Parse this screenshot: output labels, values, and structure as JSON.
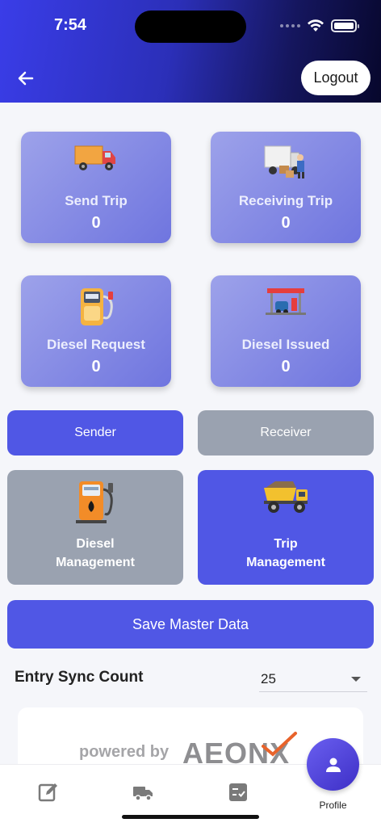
{
  "status_bar": {
    "time": "7:54"
  },
  "header": {
    "logout_label": "Logout"
  },
  "stats": [
    {
      "label": "Send Trip",
      "value": "0",
      "icon": "delivery-truck-icon"
    },
    {
      "label": "Receiving Trip",
      "value": "0",
      "icon": "unloading-truck-icon"
    },
    {
      "label": "Diesel Request",
      "value": "0",
      "icon": "fuel-pump-icon"
    },
    {
      "label": "Diesel Issued",
      "value": "0",
      "icon": "gas-station-icon"
    }
  ],
  "tabs": {
    "sender": "Sender",
    "receiver": "Receiver",
    "active": "sender"
  },
  "management": {
    "diesel": {
      "line1": "Diesel",
      "line2": "Management",
      "icon": "fuel-dispenser-icon"
    },
    "trip": {
      "line1": "Trip",
      "line2": "Management",
      "icon": "dump-truck-icon"
    }
  },
  "save_button": "Save Master Data",
  "sync": {
    "label": "Entry Sync Count",
    "value": "25"
  },
  "footer": {
    "powered_by": "powered by",
    "brand": "AEONX"
  },
  "bottom_nav": {
    "profile_label": "Profile"
  },
  "colors": {
    "primary": "#5057e5",
    "inactive": "#9aa2b0",
    "card_gradient_start": "#9da2ea",
    "card_gradient_end": "#6f75df"
  }
}
